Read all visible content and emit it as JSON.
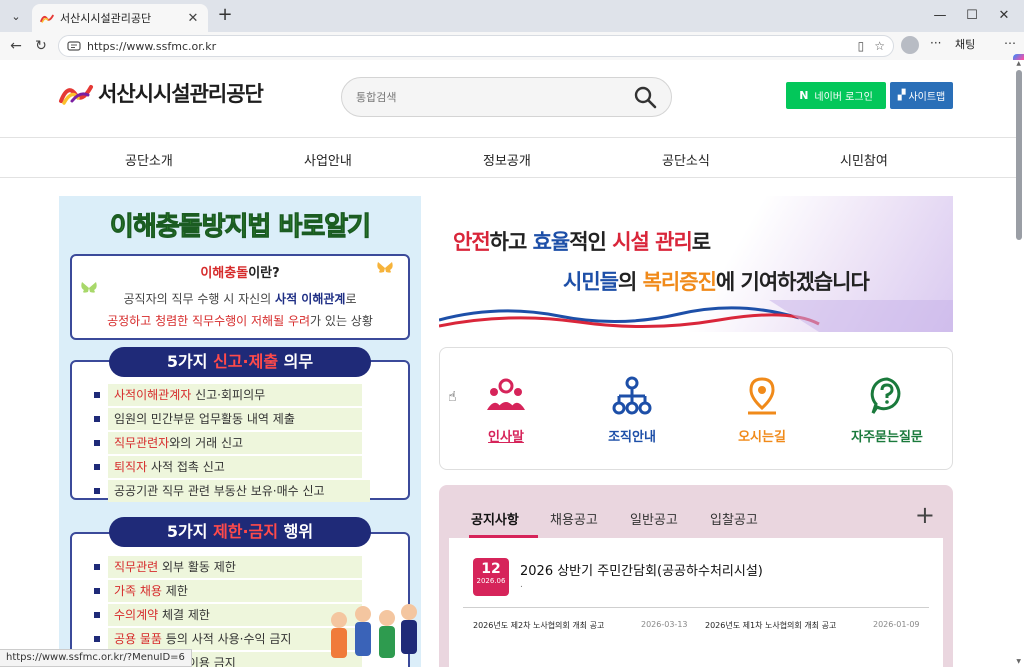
{
  "browser": {
    "tab_title": "서산시시설관리공단",
    "url": "https://www.ssfmc.or.kr",
    "copilot_label": "채팅",
    "status_url": "https://www.ssfmc.or.kr/?MenuID=6"
  },
  "header": {
    "logo_text": "서산시시설관리공단",
    "search_placeholder": "통합검색",
    "naver_login": "네이버 로그인",
    "naver_n": "N",
    "sitemap": "사이트맵"
  },
  "gnb": [
    "공단소개",
    "사업안내",
    "정보공개",
    "공단소식",
    "시민참여"
  ],
  "poster": {
    "title": "이해충돌방지법 바로알기",
    "question_red": "이해충돌",
    "question_rest": "이란?",
    "def_line1_a": "공직자의 직무 수행 시 자신의 ",
    "def_line1_b": "사적 이해관계",
    "def_line1_c": "로",
    "def_line2_a": "공정하고 청렴한 직무수행이 저해될 우려",
    "def_line2_b": "가 있는 상황",
    "section1_a": "5가지 ",
    "section1_b": "신고·제출",
    "section1_c": " 의무",
    "section1_items": [
      {
        "em": "사적이해관계자",
        "rest": " 신고·회피의무"
      },
      {
        "em": "",
        "rest": "임원의 민간부문 업무활동 내역 제출"
      },
      {
        "em": "직무관련자",
        "rest": "와의 거래 신고"
      },
      {
        "em": "퇴직자",
        "rest": " 사적 접촉 신고"
      },
      {
        "em": "",
        "rest": "공공기관 직무 관련 부동산 보유·매수 신고"
      }
    ],
    "section2_a": "5가지 ",
    "section2_b": "제한·금지",
    "section2_c": " 행위",
    "section2_items": [
      {
        "em": "직무관련",
        "rest": " 외부 활동 제한"
      },
      {
        "em": "가족 채용",
        "rest": " 제한"
      },
      {
        "em": "수의계약",
        "rest": " 체결 제한"
      },
      {
        "em": "공용 물품",
        "rest": " 등의 사적 사용·수익 금지"
      },
      {
        "em": "",
        "rest": "밀·미공개정보 이용 금지"
      }
    ]
  },
  "banner": {
    "l1_a": "안전",
    "l1_b": "하고 ",
    "l1_c": "효율",
    "l1_d": "적인 ",
    "l1_e": "시설 관리",
    "l1_f": "로",
    "l2_a": "시민들",
    "l2_b": "의 ",
    "l2_c": "복리증진",
    "l2_d": "에 기여하겠습니다"
  },
  "quick_links": [
    {
      "label": "인사말",
      "icon": "people-icon",
      "color": "#d6245a"
    },
    {
      "label": "조직안내",
      "icon": "org-chart-icon",
      "color": "#1d4fa8"
    },
    {
      "label": "오시는길",
      "icon": "location-pin-icon",
      "color": "#f08a1a"
    },
    {
      "label": "자주묻는질문",
      "icon": "question-icon",
      "color": "#1a7a3c"
    }
  ],
  "board": {
    "tabs": [
      "공지사항",
      "채용공고",
      "일반공고",
      "입찰공고"
    ],
    "active_tab": "공지사항",
    "plus": "+",
    "badge_day": "12",
    "badge_ym": "2026.06",
    "main_title": "2026 상반기 주민간담회(공공하수처리시설)",
    "main_sub": ".",
    "items": [
      {
        "title": "2026년도 제2차 노사협의회 개최 공고",
        "date": "2026-03-13"
      },
      {
        "title": "2026년도 제1차 노사협의회 개최 공고",
        "date": "2026-01-09"
      }
    ]
  },
  "colors": {
    "accent_pink": "#d6245a",
    "naver_green": "#03c75a",
    "sitemap_blue": "#2a6fb8"
  }
}
